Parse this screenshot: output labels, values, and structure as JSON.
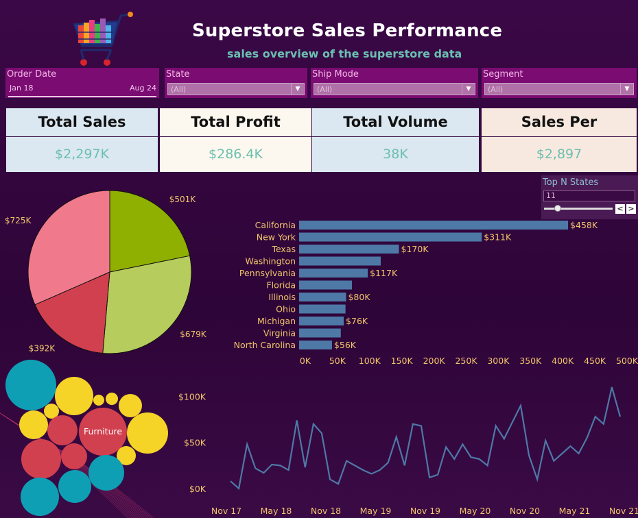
{
  "header": {
    "title": "Superstore Sales Performance",
    "subtitle": "sales overview of the superstore data"
  },
  "filters": {
    "order_date": {
      "label": "Order Date",
      "from": "Jan 18",
      "to": "Aug 24"
    },
    "state": {
      "label": "State",
      "value": "(All)"
    },
    "ship_mode": {
      "label": "Ship Mode",
      "value": "(All)"
    },
    "segment": {
      "label": "Segment",
      "value": "(All)"
    }
  },
  "kpis": [
    {
      "label": "Total Sales",
      "value": "$2,297K",
      "bg": "#dbe8f1"
    },
    {
      "label": "Total Profit",
      "value": "$286.4K",
      "bg": "#fdf8ef"
    },
    {
      "label": "Total Volume",
      "value": "38K",
      "bg": "#dbe8f1"
    },
    {
      "label": "Sales Per Customer",
      "value": "$2,897",
      "bg": "#f8e9e0"
    }
  ],
  "top_n": {
    "label": "Top N States",
    "value": "11",
    "level": 0.2
  },
  "colors": {
    "accent_text": "#f2c56b",
    "bar": "#4e79a7",
    "line": "#4e79a7",
    "kpi_value": "#6bbfb0"
  },
  "chart_data": [
    {
      "type": "pie",
      "slices": [
        {
          "value": 501,
          "label": "$501K",
          "color": "#8fb000"
        },
        {
          "value": 679,
          "label": "$679K",
          "color": "#b6cc5c"
        },
        {
          "value": 392,
          "label": "$392K",
          "color": "#d1404f"
        },
        {
          "value": 725,
          "label": "$725K",
          "color": "#f07a8c"
        }
      ]
    },
    {
      "type": "bar",
      "orientation": "horizontal",
      "categories": [
        "California",
        "New York",
        "Texas",
        "Washington",
        "Pennsylvania",
        "Florida",
        "Illinois",
        "Ohio",
        "Michigan",
        "Virginia",
        "North Carolina"
      ],
      "values": [
        458,
        311,
        170,
        139,
        117,
        90,
        80,
        79,
        76,
        71,
        56
      ],
      "labels": [
        "$458K",
        "$311K",
        "$170K",
        "",
        "$117K",
        "",
        "$80K",
        "",
        "$76K",
        "",
        "$56K"
      ],
      "xlim": [
        0,
        500
      ],
      "xticks": [
        "0K",
        "50K",
        "100K",
        "150K",
        "200K",
        "250K",
        "300K",
        "350K",
        "400K",
        "450K",
        "500K"
      ]
    },
    {
      "type": "bubble",
      "label": "Furniture",
      "groups": {
        "Furniture": "#d1404f",
        "Technology": "#f5d327",
        "Office Supplies": "#0f9fb5"
      }
    },
    {
      "type": "line",
      "ylim": [
        0,
        110
      ],
      "yticks": [
        {
          "v": 0,
          "label": "$0K"
        },
        {
          "v": 50,
          "label": "$50K"
        },
        {
          "v": 100,
          "label": "$100K"
        }
      ],
      "xticks": [
        "Nov 17",
        "May 18",
        "Nov 18",
        "May 19",
        "Nov 19",
        "May 20",
        "Nov 20",
        "May 21",
        "Nov 21"
      ],
      "values": [
        8,
        0,
        48,
        22,
        17,
        26,
        25,
        20,
        74,
        23,
        70,
        60,
        10,
        5,
        30,
        25,
        20,
        16,
        20,
        28,
        56,
        25,
        70,
        68,
        12,
        15,
        45,
        32,
        48,
        34,
        32,
        25,
        68,
        54,
        72,
        90,
        36,
        10,
        52,
        30,
        38,
        46,
        38,
        55,
        78,
        70,
        110,
        78
      ]
    }
  ]
}
